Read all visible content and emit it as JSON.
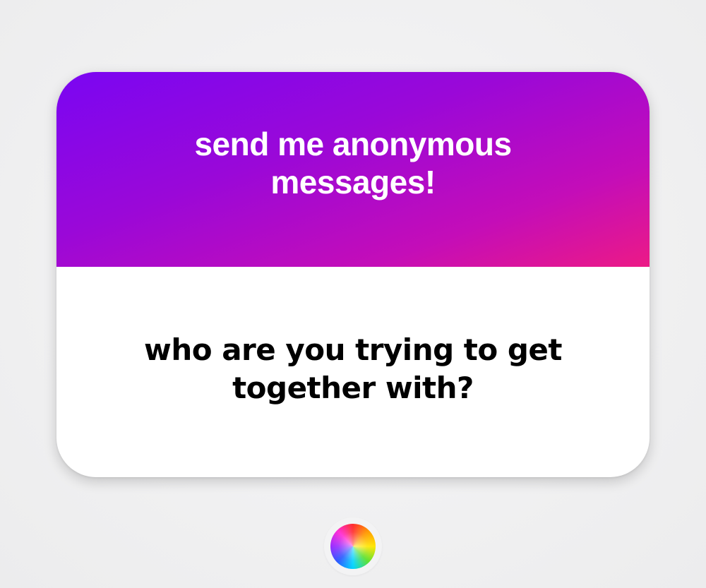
{
  "card": {
    "header_title": "send me anonymous messages!",
    "question": "who are you trying to get together with?"
  },
  "controls": {
    "color_wheel_icon": "color-wheel-icon"
  },
  "colors": {
    "gradient_start": "#7a06f2",
    "gradient_end": "#ec1a86",
    "question_text": "#000000",
    "header_text": "#ffffff"
  }
}
